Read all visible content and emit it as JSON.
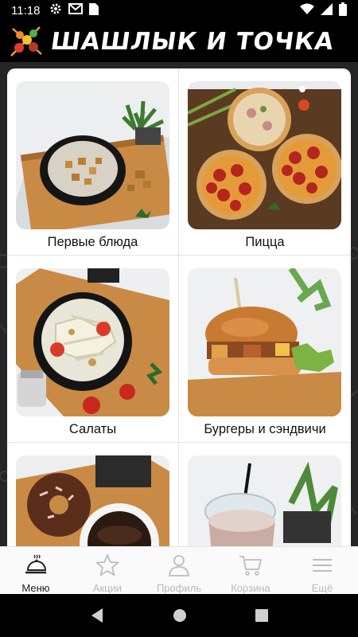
{
  "status_bar": {
    "time": "11:18",
    "icons_left": [
      "settings-icon",
      "mail-icon",
      "sim-card-icon"
    ],
    "icons_right": [
      "wifi-icon",
      "cellular-icon",
      "battery-icon"
    ]
  },
  "header": {
    "brand": "ШАШЛЫК И ТОЧКА",
    "logo_icon": "skewers-logo-icon"
  },
  "categories": [
    {
      "label": "Первые блюда",
      "image": "soup-photo"
    },
    {
      "label": "Пицца",
      "image": "pizza-photo"
    },
    {
      "label": "Салаты",
      "image": "salad-photo"
    },
    {
      "label": "Бургеры и сэндвичи",
      "image": "burger-photo"
    },
    {
      "label": "",
      "image": "donut-coffee-photo"
    },
    {
      "label": "",
      "image": "milkshake-photo"
    }
  ],
  "bottom_nav": {
    "items": [
      {
        "label": "Меню",
        "icon": "cloche-icon",
        "active": true
      },
      {
        "label": "Акции",
        "icon": "star-icon",
        "active": false
      },
      {
        "label": "Профиль",
        "icon": "person-icon",
        "active": false
      },
      {
        "label": "Корзина",
        "icon": "cart-icon",
        "active": false
      },
      {
        "label": "Ещё",
        "icon": "hamburger-menu-icon",
        "active": false
      }
    ]
  },
  "colors": {
    "header_bg": "#000000",
    "active_nav": "#222222",
    "inactive_nav": "#b9b9b9"
  }
}
